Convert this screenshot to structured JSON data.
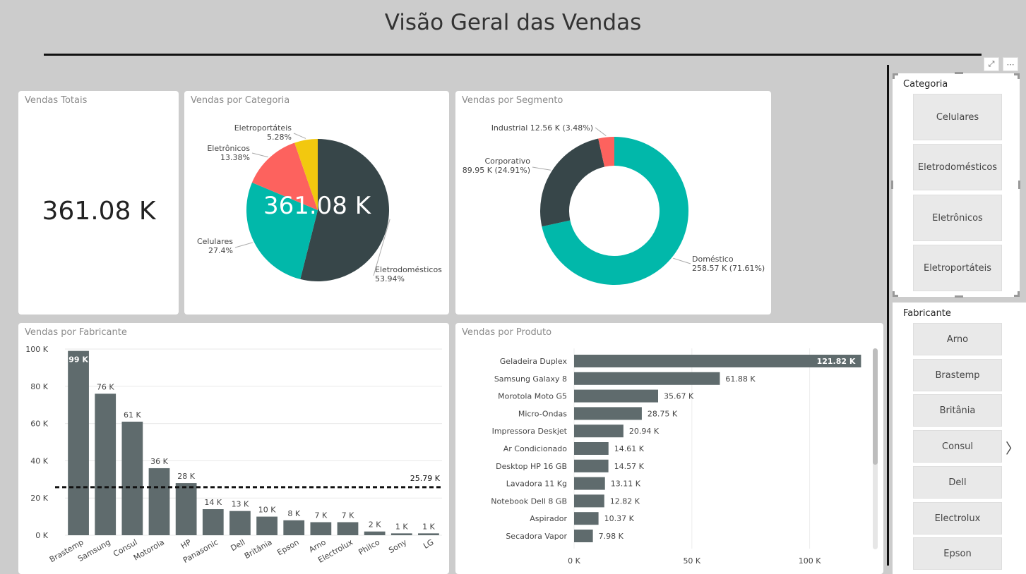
{
  "header": {
    "title": "Visão Geral das Vendas"
  },
  "kpi": {
    "title": "Vendas Totais",
    "value": "361.08 K"
  },
  "categoria": {
    "title": "Vendas por Categoria",
    "center_value": "361.08 K"
  },
  "segmento": {
    "title": "Vendas por Segmento"
  },
  "fabricante_chart": {
    "title": "Vendas por Fabricante"
  },
  "produto_chart": {
    "title": "Vendas por Produto"
  },
  "slicers": {
    "categoria": {
      "title": "Categoria",
      "items": [
        "Celulares",
        "Eletrodomésticos",
        "Eletrônicos",
        "Eletroportáteis"
      ]
    },
    "fabricante": {
      "title": "Fabricante",
      "items": [
        "Arno",
        "Brastemp",
        "Britânia",
        "Consul",
        "Dell",
        "Electrolux",
        "Epson"
      ]
    }
  },
  "icons": {
    "focus": "focus-mode-icon",
    "more": "more-options-icon",
    "next": "chevron-right-icon"
  },
  "chart_data": [
    {
      "type": "pie",
      "title": "Vendas por Categoria",
      "slices": [
        {
          "label": "Eletrodomésticos",
          "pct_label": "53.94%",
          "value": 53.94,
          "color": "#374649"
        },
        {
          "label": "Celulares",
          "pct_label": "27.4%",
          "value": 27.4,
          "color": "#01B8AA"
        },
        {
          "label": "Eletrônicos",
          "pct_label": "13.38%",
          "value": 13.38,
          "color": "#FD625E"
        },
        {
          "label": "Eletroportáteis",
          "pct_label": "5.28%",
          "value": 5.28,
          "color": "#F2C80F"
        }
      ]
    },
    {
      "type": "pie",
      "title": "Vendas por Segmento",
      "donut": true,
      "slices": [
        {
          "label": "Doméstico",
          "detail": "258.57 K (71.61%)",
          "value": 71.61,
          "color": "#01B8AA"
        },
        {
          "label": "Corporativo",
          "detail": "89.95 K (24.91%)",
          "value": 24.91,
          "color": "#374649"
        },
        {
          "label": "Industrial",
          "detail": "12.56 K (3.48%)",
          "value": 3.48,
          "color": "#FD625E"
        }
      ]
    },
    {
      "type": "bar",
      "title": "Vendas por Fabricante",
      "categories": [
        "Brastemp",
        "Samsung",
        "Consul",
        "Motorola",
        "HP",
        "Panasonic",
        "Dell",
        "Britânia",
        "Epson",
        "Arno",
        "Electrolux",
        "Philco",
        "Sony",
        "LG"
      ],
      "values": [
        99,
        76,
        61,
        36,
        28,
        14,
        13,
        10,
        8,
        7,
        7,
        2,
        1,
        1
      ],
      "value_labels": [
        "99 K",
        "76 K",
        "61 K",
        "36 K",
        "28 K",
        "14 K",
        "13 K",
        "10 K",
        "8 K",
        "7 K",
        "7 K",
        "2 K",
        "1 K",
        "1 K"
      ],
      "yticks": [
        "0 K",
        "20 K",
        "40 K",
        "60 K",
        "80 K",
        "100 K"
      ],
      "ylim": [
        0,
        100
      ],
      "reference_line": {
        "value": 25.79,
        "label": "25.79 K"
      },
      "color": "#5F6B6D"
    },
    {
      "type": "bar",
      "orientation": "horizontal",
      "title": "Vendas por Produto",
      "categories": [
        "Geladeira Duplex",
        "Samsung Galaxy 8",
        "Morotola Moto G5",
        "Micro-Ondas",
        "Impressora Deskjet",
        "Ar Condicionado",
        "Desktop HP 16 GB",
        "Lavadora 11 Kg",
        "Notebook Dell 8 GB",
        "Aspirador",
        "Secadora Vapor"
      ],
      "values": [
        121.82,
        61.88,
        35.67,
        28.75,
        20.94,
        14.61,
        14.57,
        13.11,
        12.82,
        10.37,
        7.98
      ],
      "value_labels": [
        "121.82 K",
        "61.88 K",
        "35.67 K",
        "28.75 K",
        "20.94 K",
        "14.61 K",
        "14.57 K",
        "13.11 K",
        "12.82 K",
        "10.37 K",
        "7.98 K"
      ],
      "xticks": [
        "0 K",
        "50 K",
        "100 K"
      ],
      "xlim": [
        0,
        122
      ],
      "color": "#5F6B6D"
    }
  ]
}
